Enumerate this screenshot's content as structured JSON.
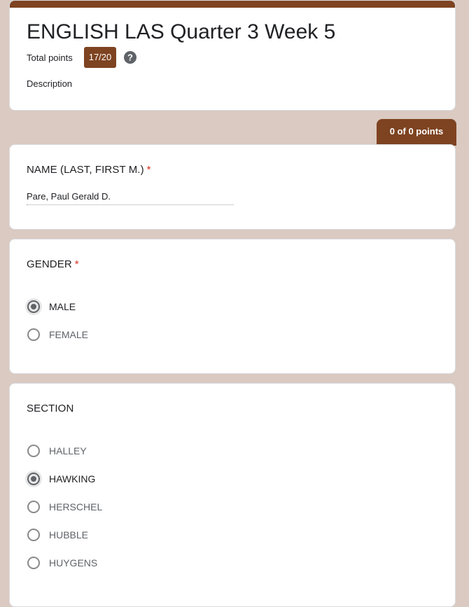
{
  "header": {
    "title": "ENGLISH LAS Quarter 3 Week 5",
    "total_points_label": "Total points",
    "score": "17/20",
    "description": "Description",
    "accent_color": "#7e4321",
    "help_icon": "help-icon"
  },
  "points_tab": {
    "label": "0 of 0 points"
  },
  "questions": {
    "name": {
      "title": "NAME (LAST, FIRST M.)",
      "required_marker": "*",
      "answer": "Pare, Paul Gerald D."
    },
    "gender": {
      "title": "GENDER",
      "required_marker": "*",
      "options": [
        {
          "label": "MALE",
          "selected": true
        },
        {
          "label": "FEMALE",
          "selected": false
        }
      ]
    },
    "section": {
      "title": "SECTION",
      "options": [
        {
          "label": "HALLEY",
          "selected": false
        },
        {
          "label": "HAWKING",
          "selected": true
        },
        {
          "label": "HERSCHEL",
          "selected": false
        },
        {
          "label": "HUBBLE",
          "selected": false
        },
        {
          "label": "HUYGENS",
          "selected": false
        }
      ]
    }
  },
  "colors": {
    "page_background": "#dacac1",
    "required": "#d93025"
  }
}
